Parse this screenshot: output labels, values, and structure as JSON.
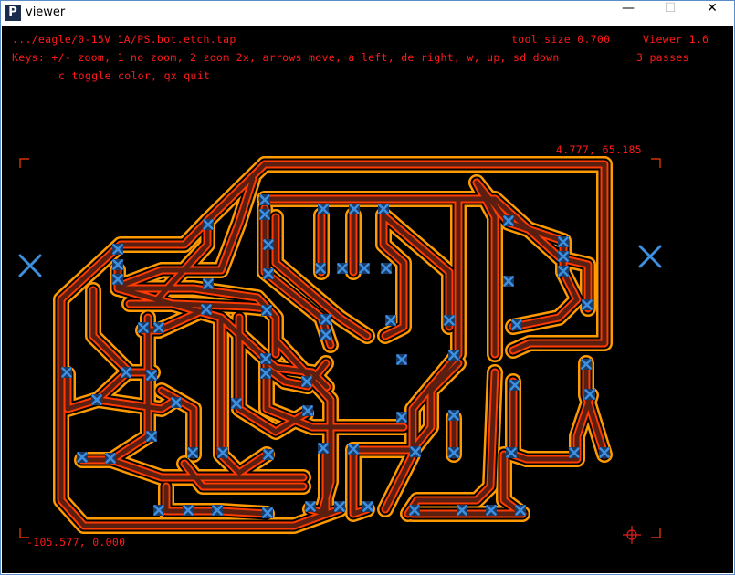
{
  "window": {
    "title": "viewer",
    "icon": "P",
    "minimize_glyph": "—",
    "maximize_glyph": "☐",
    "close_glyph": "✕"
  },
  "hud": {
    "file_path": ".../eagle/0-15V 1A/PS.bot.etch.tap",
    "tool_size": "tool size 0.700",
    "viewer_version": "Viewer 1.6",
    "keys_line1": "Keys: +/- zoom, 1 no zoom, 2 zoom 2x, arrows move, a left, de right, w, up, sd down",
    "keys_line2": "c toggle color, qx quit",
    "passes": "3 passes",
    "max_coord": "4.777, 65.185",
    "min_coord": "-105.577, 0.000"
  },
  "colors": {
    "background": "#000000",
    "hud_text": "#ff1a1a",
    "outer_pass": "#ff9a00",
    "middle_pass": "#ff3b00",
    "track": "#5a1f10",
    "pad_marker": "#3d8fe0",
    "origin_marker": "#e0201e"
  }
}
